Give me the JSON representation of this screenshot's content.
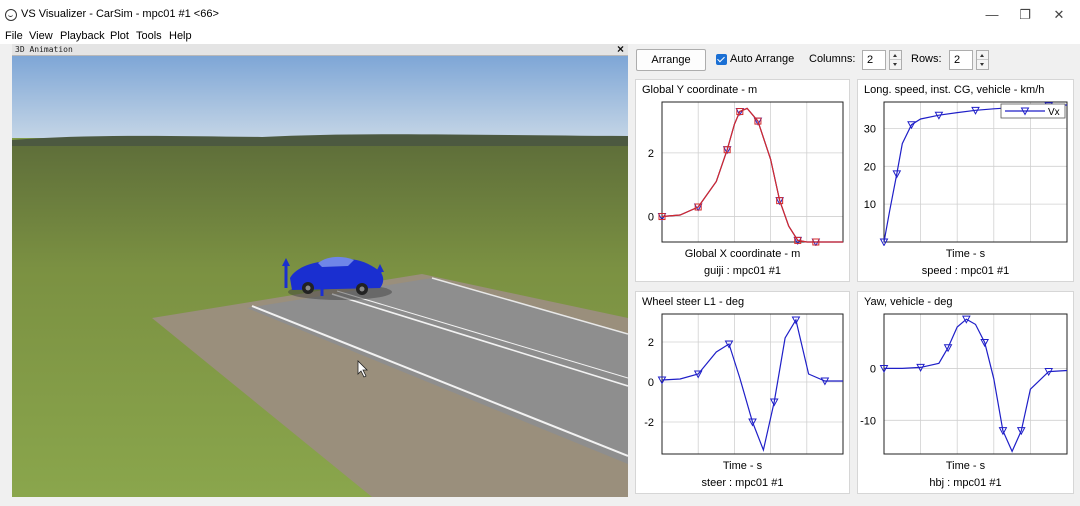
{
  "window": {
    "title": "VS Visualizer - CarSim - mpc01 #1 <66>",
    "minimize": "—",
    "restore": "❐",
    "close": "✕"
  },
  "menu": [
    "File",
    "View",
    "Playback",
    "Plot",
    "Tools",
    "Help"
  ],
  "animation": {
    "title": "3D Animation",
    "close": "×"
  },
  "toolbar": {
    "arrange_label": "Arrange",
    "auto_arrange_label": "Auto Arrange",
    "auto_arrange_checked": true,
    "columns_label": "Columns:",
    "columns_value": "2",
    "rows_label": "Rows:",
    "rows_value": "2"
  },
  "colors": {
    "accent": "#1a6fd4",
    "series_blue": "#1f1fc8",
    "series_red": "#d42a2a",
    "car": "#1a2fd0",
    "grass": "#7f9a44",
    "road": "#8e8e8e",
    "sky": "#8fb3dc"
  },
  "chart_data": [
    {
      "type": "line",
      "title": "Global Y coordinate - m",
      "xlabel": "Global X coordinate - m",
      "caption": "guiji : mpc01 #1",
      "xlim": [
        0,
        10
      ],
      "ylim": [
        -0.8,
        3.6
      ],
      "yticks": [
        0,
        2
      ],
      "grid": true,
      "series": [
        {
          "color": "#1f1fc8",
          "marker": "triangle",
          "x": [
            0,
            1,
            2,
            3,
            3.6,
            4,
            4.3,
            4.7,
            5.3,
            6,
            6.5,
            7,
            7.5,
            8,
            8.5,
            10
          ],
          "y": [
            0,
            0.05,
            0.3,
            1.1,
            2.1,
            2.9,
            3.3,
            3.4,
            3.0,
            1.8,
            0.5,
            -0.3,
            -0.75,
            -0.8,
            -0.8,
            -0.8
          ]
        },
        {
          "color": "#d42a2a",
          "marker": "square",
          "x": [
            0,
            1,
            2,
            3,
            3.6,
            4,
            4.3,
            4.7,
            5.3,
            6,
            6.5,
            7,
            7.5,
            8,
            8.5,
            10
          ],
          "y": [
            0,
            0.05,
            0.3,
            1.1,
            2.1,
            2.9,
            3.3,
            3.4,
            3.0,
            1.8,
            0.5,
            -0.3,
            -0.75,
            -0.8,
            -0.8,
            -0.8
          ]
        }
      ]
    },
    {
      "type": "line",
      "title": "Long. speed, inst. CG, vehicle - km/h",
      "xlabel": "Time - s",
      "caption": "speed : mpc01 #1",
      "xlim": [
        0,
        10
      ],
      "ylim": [
        0,
        37
      ],
      "yticks": [
        10,
        20,
        30
      ],
      "grid": true,
      "legend": {
        "label": "Vx",
        "position": "top-right"
      },
      "series": [
        {
          "color": "#1f1fc8",
          "marker": "triangle",
          "x": [
            0,
            0.3,
            0.7,
            1,
            1.5,
            2,
            3,
            4,
            5,
            6,
            7,
            8,
            9,
            10
          ],
          "y": [
            0,
            8,
            18,
            26,
            31,
            32.5,
            33.5,
            34.2,
            34.8,
            35.2,
            35.5,
            35.8,
            36,
            36.2
          ]
        }
      ]
    },
    {
      "type": "line",
      "title": "Wheel steer L1 - deg",
      "xlabel": "Time - s",
      "caption": "steer : mpc01 #1",
      "xlim": [
        0,
        10
      ],
      "ylim": [
        -3.6,
        3.4
      ],
      "yticks": [
        -2,
        0,
        2
      ],
      "grid": true,
      "series": [
        {
          "color": "#1f1fc8",
          "marker": "triangle",
          "x": [
            0,
            1,
            2,
            3,
            3.7,
            4.3,
            5,
            5.6,
            6.2,
            6.8,
            7.4,
            8.1,
            9,
            10
          ],
          "y": [
            0.1,
            0.15,
            0.4,
            1.5,
            1.9,
            0.2,
            -2.0,
            -3.4,
            -1.0,
            2.2,
            3.1,
            0.4,
            0.05,
            0.05
          ]
        }
      ]
    },
    {
      "type": "line",
      "title": "Yaw, vehicle - deg",
      "xlabel": "Time - s",
      "caption": "hbj : mpc01 #1",
      "xlim": [
        0,
        10
      ],
      "ylim": [
        -16.5,
        10.5
      ],
      "yticks": [
        -10,
        0
      ],
      "grid": true,
      "series": [
        {
          "color": "#1f1fc8",
          "marker": "triangle",
          "x": [
            0,
            1,
            2,
            3,
            3.5,
            4,
            4.5,
            5,
            5.5,
            6,
            6.5,
            7,
            7.5,
            8,
            9,
            10
          ],
          "y": [
            0,
            0,
            0.2,
            1,
            4,
            8,
            9.5,
            8.5,
            5,
            -2,
            -12,
            -16,
            -12,
            -4,
            -0.6,
            -0.4
          ]
        }
      ]
    }
  ]
}
